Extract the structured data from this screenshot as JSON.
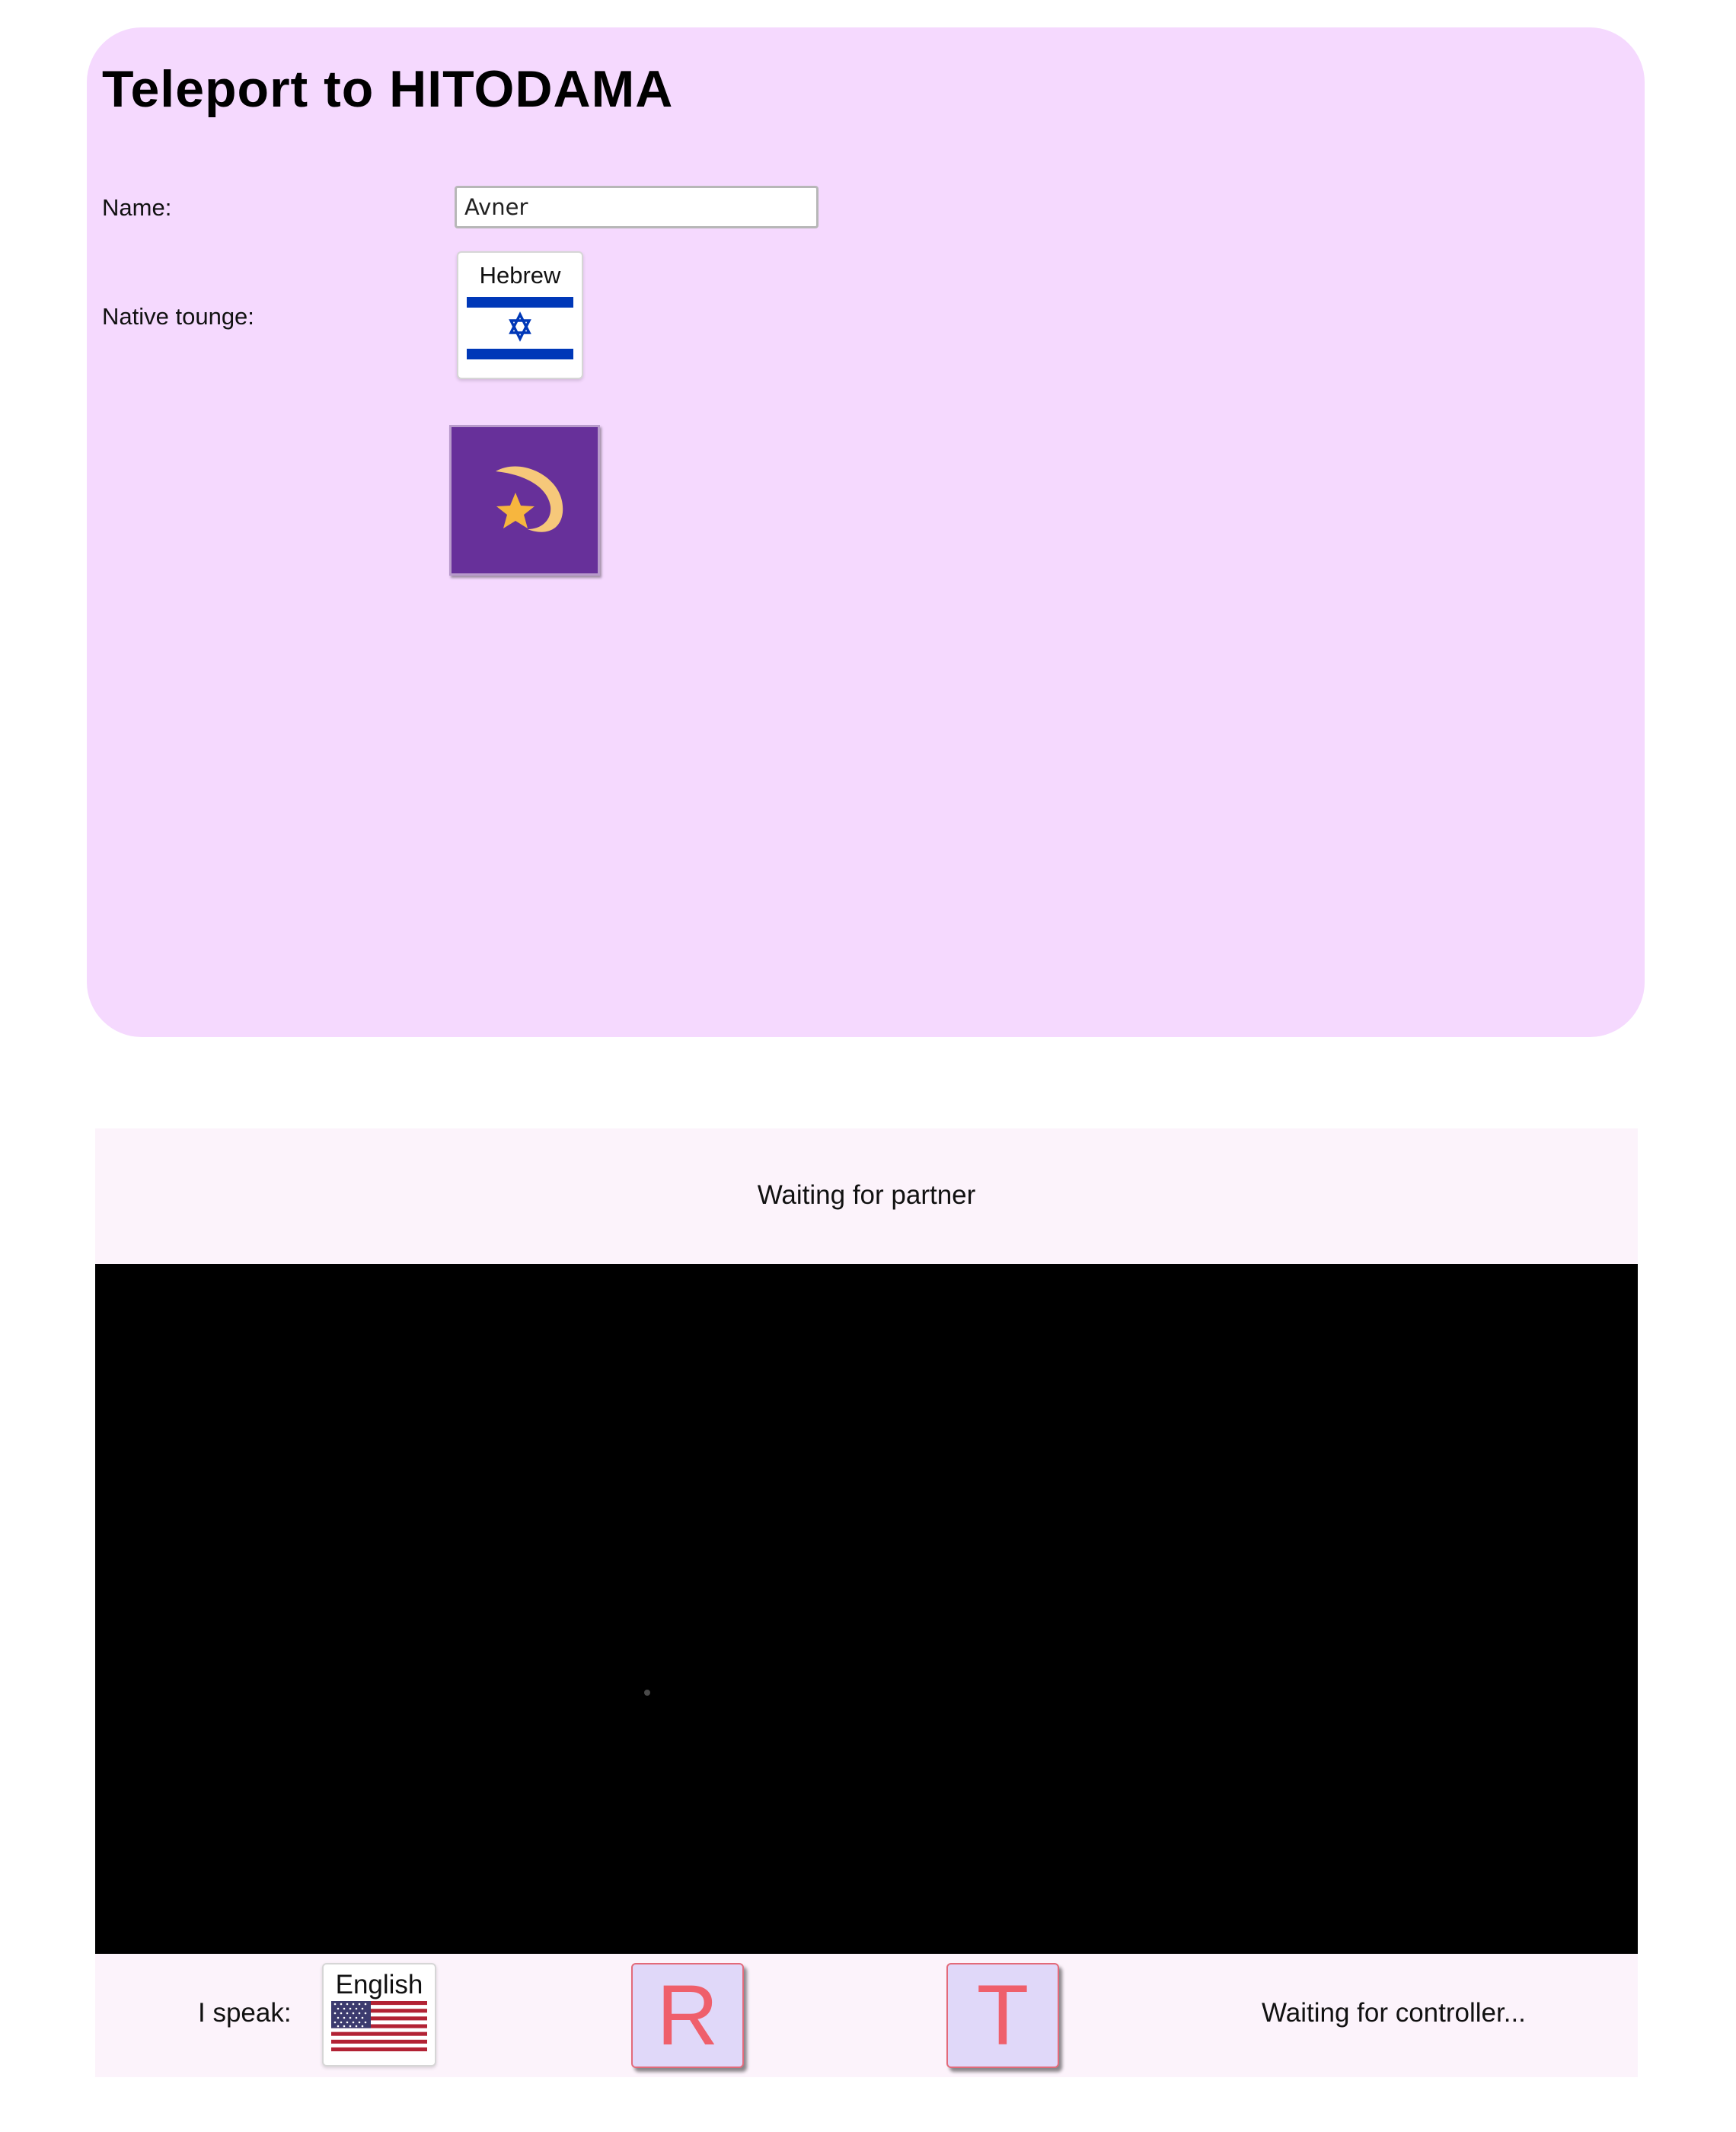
{
  "header": {
    "title": "Teleport to HITODAMA"
  },
  "form": {
    "name_label": "Name:",
    "name_value": "Avner",
    "native_tongue_label": "Native tounge:",
    "native_tongue": {
      "language": "Hebrew",
      "flag_icon": "israel-flag-icon"
    },
    "logo_icon": "shooting-star-icon"
  },
  "call": {
    "partner_status": "Waiting for partner",
    "speak_label": "I speak:",
    "speak_language": {
      "language": "English",
      "flag_icon": "us-flag-icon"
    },
    "r_button_label": "R",
    "t_button_label": "T",
    "controller_status": "Waiting for controller..."
  },
  "colors": {
    "panel_background": "#f5d9fe",
    "logo_background": "#67309a",
    "call_bar_background": "#fcf3fb",
    "letter_button_background": "#e0d8f9",
    "letter_button_text": "#ef5f6b",
    "flag_blue": "#0038b8"
  }
}
